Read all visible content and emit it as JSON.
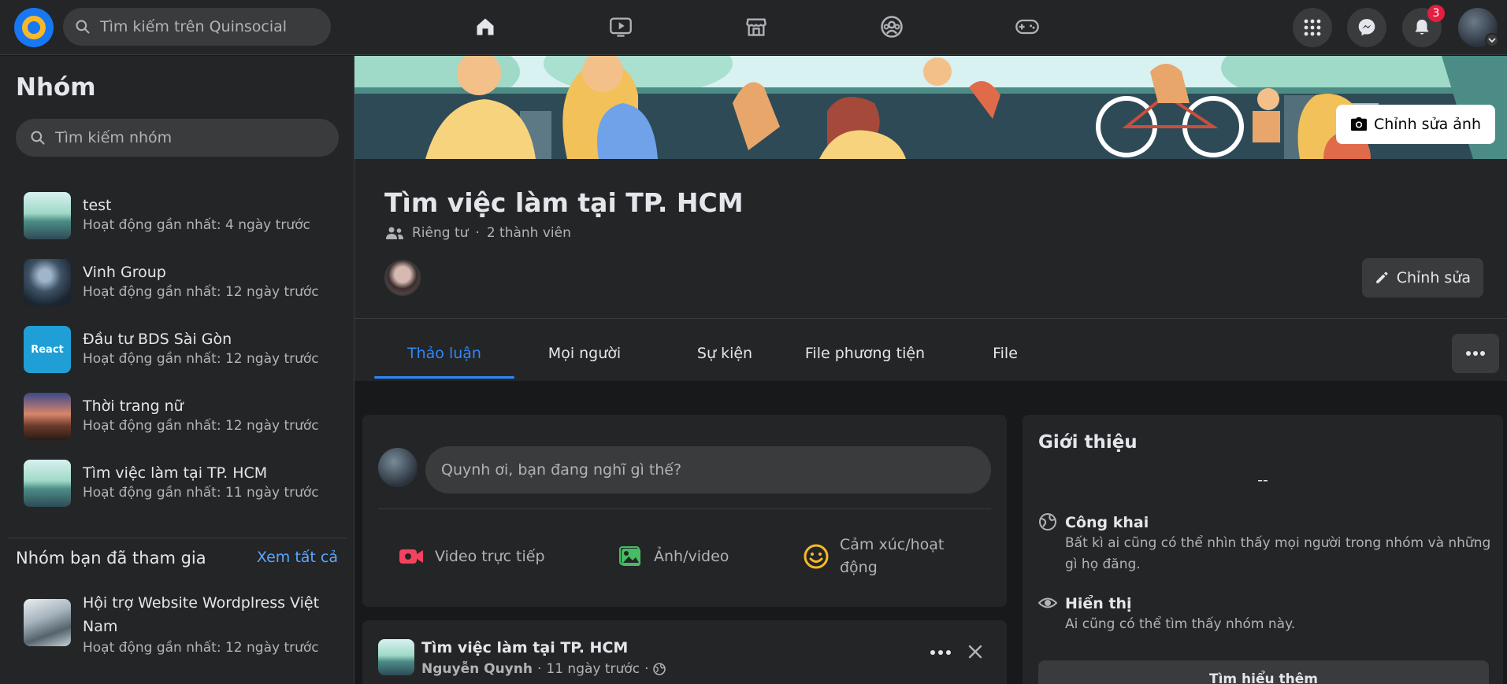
{
  "topbar": {
    "search_placeholder": "Tìm kiếm trên Quinsocial",
    "notification_count": "3",
    "nav_icons": [
      "home-icon",
      "video-icon",
      "marketplace-icon",
      "groups-icon",
      "gaming-icon"
    ],
    "active_color": "#2d88ff"
  },
  "sidebar": {
    "title": "Nhóm",
    "search_placeholder": "Tìm kiếm nhóm",
    "groups": [
      {
        "name": "test",
        "meta": "Hoạt động gần nhất: 4 ngày trước"
      },
      {
        "name": "Vinh Group",
        "meta": "Hoạt động gần nhất: 12 ngày trước"
      },
      {
        "name": "Đầu tư BDS Sài Gòn",
        "meta": "Hoạt động gần nhất: 12 ngày trước",
        "thumb_text": "React"
      },
      {
        "name": "Thời trang nữ",
        "meta": "Hoạt động gần nhất: 12 ngày trước"
      },
      {
        "name": "Tìm việc làm tại TP. HCM",
        "meta": "Hoạt động gần nhất: 11 ngày trước"
      }
    ],
    "joined_title": "Nhóm bạn đã tham gia",
    "see_all": "Xem tất cả",
    "joined": [
      {
        "name": "Hội trợ Website Wordplress Việt Nam",
        "meta": "Hoạt động gần nhất: 12 ngày trước"
      }
    ]
  },
  "group": {
    "edit_cover_label": "Chỉnh sửa ảnh",
    "title": "Tìm việc làm tại TP. HCM",
    "privacy": "Riêng tư",
    "separator": "·",
    "members": "2 thành viên",
    "edit_label": "Chỉnh sửa",
    "tabs": [
      "Thảo luận",
      "Mọi người",
      "Sự kiện",
      "File phương tiện",
      "File"
    ]
  },
  "composer": {
    "placeholder": "Quynh ơi, bạn đang nghĩ gì thế?",
    "actions": [
      {
        "label": "Video trực tiếp",
        "color": "#f3425f"
      },
      {
        "label": "Ảnh/video",
        "color": "#45bd62"
      },
      {
        "label": "Cảm xúc/hoạt động",
        "color": "#f7b928"
      }
    ]
  },
  "post": {
    "group": "Tìm việc làm tại TP. HCM",
    "author": "Nguyễn Quynh",
    "time": "11 ngày trước",
    "dot": "·"
  },
  "about": {
    "title": "Giới thiệu",
    "description": "--",
    "public_title": "Công khai",
    "public_text": "Bất kì ai cũng có thể nhìn thấy mọi người trong nhóm và những gì họ đăng.",
    "visible_title": "Hiển thị",
    "visible_text": "Ai cũng có thể tìm thấy nhóm này.",
    "learn_more": "Tìm hiểu thêm"
  }
}
